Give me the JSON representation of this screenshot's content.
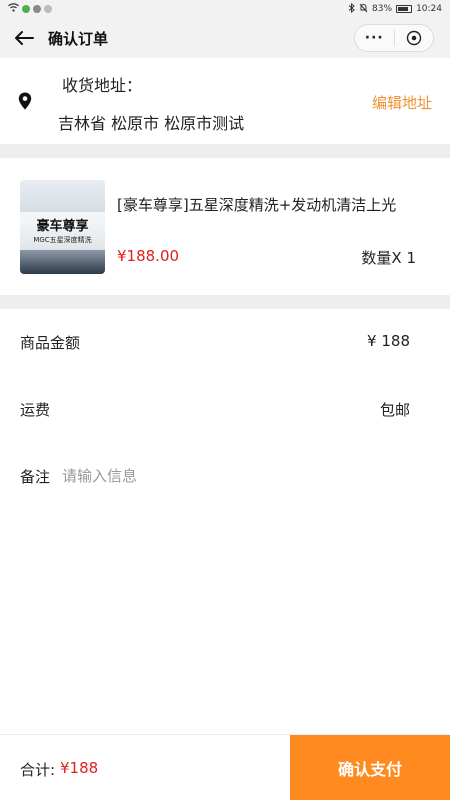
{
  "status_bar": {
    "battery_text": "83%",
    "time": "10:24"
  },
  "nav": {
    "title": "确认订单",
    "more_label": "···"
  },
  "address": {
    "label": "收货地址：",
    "value": "吉林省 松原市 松原市测试",
    "edit_label": "编辑地址"
  },
  "product": {
    "thumb_title": "豪车尊享",
    "thumb_subtitle": "MGC五星深度精洗",
    "name": "[豪车尊享]五星深度精洗+发动机清洁上光",
    "price": "¥188.00",
    "quantity": "数量X 1"
  },
  "summary": {
    "goods_amount_label": "商品金额",
    "goods_amount_value": "¥ 188",
    "shipping_label": "运费",
    "shipping_value": "包邮",
    "remark_label": "备注",
    "remark_placeholder": "请输入信息",
    "remark_value": ""
  },
  "footer": {
    "total_label": "合计:",
    "total_value": "¥188",
    "pay_label": "确认支付"
  },
  "colors": {
    "accent_orange": "#ff8a1f",
    "edit_link": "#f0922f",
    "price_red": "#e02020"
  }
}
